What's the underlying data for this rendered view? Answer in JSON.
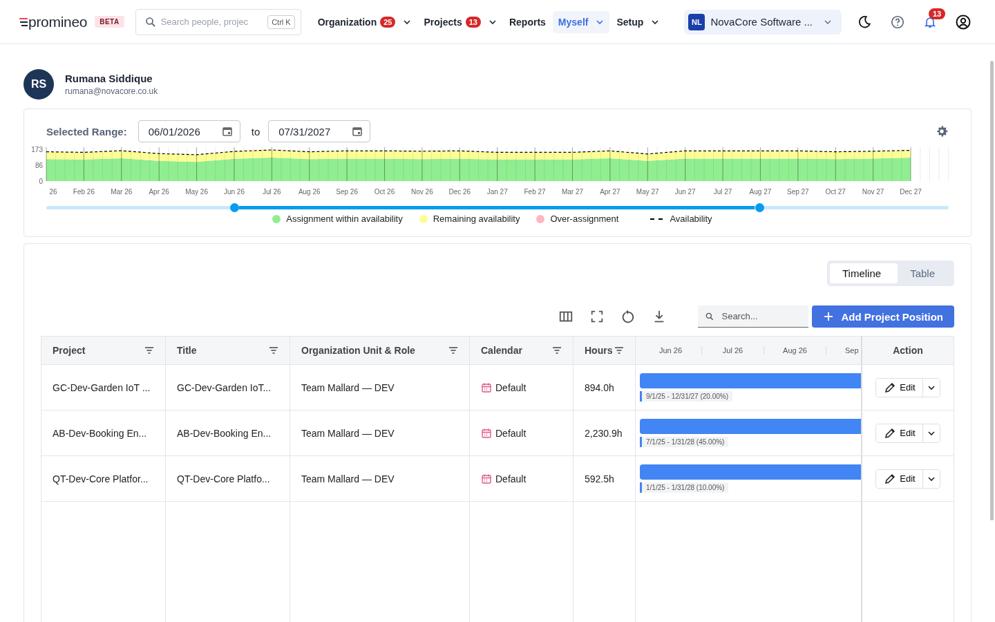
{
  "header": {
    "logo": "promineo",
    "beta_badge": "BETA",
    "search": {
      "placeholder": "Search people, projec",
      "shortcut": "Ctrl K"
    },
    "nav": [
      {
        "label": "Organization",
        "badge": "25",
        "dropdown": true,
        "selected": false
      },
      {
        "label": "Projects",
        "badge": "13",
        "dropdown": true,
        "selected": false
      },
      {
        "label": "Reports",
        "dropdown": false,
        "selected": false
      },
      {
        "label": "Myself",
        "dropdown": true,
        "selected": true
      },
      {
        "label": "Setup",
        "dropdown": true,
        "selected": false
      }
    ],
    "company": {
      "initials": "NL",
      "name": "NovaCore Software ..."
    },
    "notifications_badge": "13"
  },
  "profile": {
    "initials": "RS",
    "name": "Rumana Siddique",
    "email": "rumana@novacore.co.uk"
  },
  "range": {
    "label": "Selected Range:",
    "from": "06/01/2026",
    "separator": "to",
    "to": "07/31/2027"
  },
  "availability_chart": {
    "chart_data": {
      "type": "area",
      "stacked": true,
      "grid": true,
      "categories": [
        "26",
        "Feb 26",
        "Mar 26",
        "Apr 26",
        "May 26",
        "Jun 26",
        "Jul 26",
        "Aug 26",
        "Sep 26",
        "Oct 26",
        "Nov 26",
        "Dec 26",
        "Jan 27",
        "Feb 27",
        "Mar 27",
        "Apr 27",
        "May 27",
        "Jun 27",
        "Jul 27",
        "Aug 27",
        "Sep 27",
        "Oct 27",
        "Nov 27",
        "Dec 27"
      ],
      "ylim": [
        0,
        185
      ],
      "yticks": [
        0,
        86,
        173
      ],
      "series": [
        {
          "name": "Assignment within availability",
          "color": "#90ee90",
          "values": [
            120,
            118,
            125,
            110,
            105,
            122,
            128,
            120,
            122,
            122,
            120,
            122,
            118,
            118,
            118,
            125,
            110,
            123,
            123,
            123,
            123,
            120,
            123,
            128
          ]
        },
        {
          "name": "Remaining availability",
          "color": "#fdfd96",
          "values": [
            40,
            39,
            41,
            40,
            39,
            40,
            42,
            40,
            43,
            43,
            43,
            43,
            39,
            39,
            39,
            40,
            38,
            42,
            42,
            42,
            42,
            40,
            40,
            40
          ]
        }
      ]
    },
    "extra_legend": [
      {
        "kind": "dot",
        "label": "Over-assignment",
        "color": "#ffb6c1"
      },
      {
        "kind": "dashed",
        "label": "Availability"
      }
    ]
  },
  "range_slider": {
    "thumbs": [
      {
        "level": 0.208
      },
      {
        "level": 0.79
      }
    ]
  },
  "view_toggle": [
    {
      "label": "Timeline",
      "selected": true
    },
    {
      "label": "Table",
      "selected": false
    }
  ],
  "toolbar": {
    "search_placeholder": "Search...",
    "add_button": "Add Project Position"
  },
  "table": {
    "columns": [
      {
        "label": "Project",
        "filter": true
      },
      {
        "label": "Title",
        "filter": true
      },
      {
        "label": "Organization Unit & Role",
        "filter": true
      },
      {
        "label": "Calendar",
        "filter": true
      },
      {
        "label": "Hours",
        "filter": true
      }
    ],
    "timeline_months": [
      "Jun 26",
      "Jul 26",
      "Aug 26",
      "Sep"
    ],
    "action_header": "Action",
    "rows": [
      {
        "project": "GC-Dev-Garden IoT ...",
        "title": "GC-Dev-Garden IoT...",
        "org_role": "Team Mallard — DEV",
        "calendar": "Default",
        "hours": "894.0h",
        "bar_label": "9/1/25 - 12/31/27 (20.00%)",
        "action": "Edit"
      },
      {
        "project": "AB-Dev-Booking En...",
        "title": "AB-Dev-Booking En...",
        "org_role": "Team Mallard — DEV",
        "calendar": "Default",
        "hours": "2,230.9h",
        "bar_label": "7/1/25 - 1/31/28 (45.00%)",
        "action": "Edit"
      },
      {
        "project": "QT-Dev-Core Platfor...",
        "title": "QT-Dev-Core Platfo...",
        "org_role": "Team Mallard — DEV",
        "calendar": "Default",
        "hours": "592.5h",
        "bar_label": "1/1/25 - 1/31/28 (10.00%)",
        "action": "Edit"
      }
    ]
  }
}
